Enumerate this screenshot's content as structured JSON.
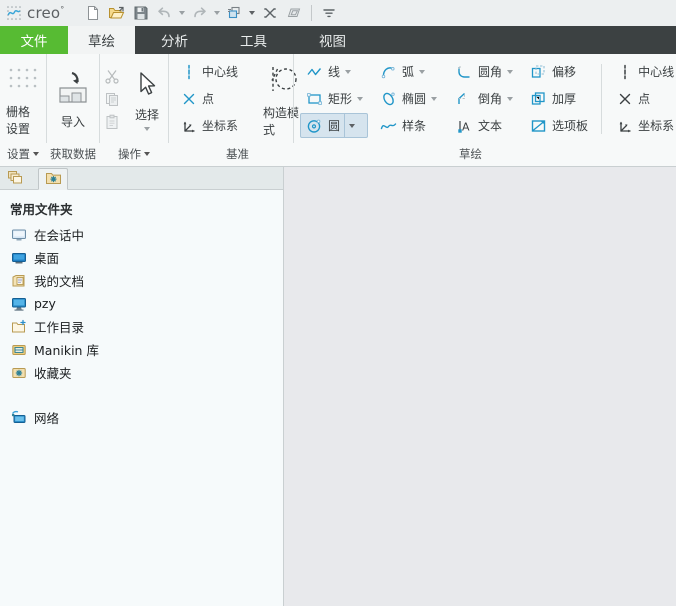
{
  "app": {
    "brand": "creo",
    "brand_sup": "°"
  },
  "quick_access": {
    "buttons": [
      {
        "name": "new-file",
        "icon": "new-document-icon"
      },
      {
        "name": "open-file",
        "icon": "open-folder-icon"
      },
      {
        "name": "save-file",
        "icon": "save-disk-icon"
      },
      {
        "name": "undo",
        "icon": "undo-arrow-icon",
        "has_caret": true
      },
      {
        "name": "redo",
        "icon": "redo-arrow-icon",
        "has_caret": true
      },
      {
        "name": "regenerate",
        "icon": "regenerate-icon",
        "has_caret": true
      },
      {
        "name": "close-window",
        "icon": "close-x-icon"
      },
      {
        "name": "window-switch",
        "icon": "window-stack-icon"
      }
    ],
    "overflow": "customize-quick-access-icon"
  },
  "tabs": [
    {
      "id": "file",
      "label": "文件",
      "state": "file"
    },
    {
      "id": "sketch",
      "label": "草绘",
      "state": "active"
    },
    {
      "id": "analysis",
      "label": "分析",
      "state": "normal"
    },
    {
      "id": "tools",
      "label": "工具",
      "state": "normal"
    },
    {
      "id": "view",
      "label": "视图",
      "state": "normal"
    }
  ],
  "ribbon": {
    "groups": [
      {
        "id": "settings",
        "label": "设置",
        "label_caret": true,
        "big_buttons": [
          {
            "name": "grid-settings-button",
            "label": "栅格设置",
            "icon": "grid-dots-icon"
          }
        ]
      },
      {
        "id": "get-data",
        "label": "获取数据",
        "label_caret": false,
        "big_buttons": [
          {
            "name": "import-button",
            "label": "导入",
            "icon": "import-arrow-icon"
          }
        ]
      },
      {
        "id": "operations",
        "label": "操作",
        "label_caret": true,
        "small_icons": [
          {
            "name": "cut-button",
            "icon": "scissors-icon",
            "disabled": true
          },
          {
            "name": "copy-button",
            "icon": "copy-pages-icon",
            "disabled": true
          },
          {
            "name": "paste-button",
            "icon": "clipboard-icon",
            "disabled": true
          }
        ],
        "big_buttons": [
          {
            "name": "select-button",
            "label": "选择",
            "icon": "cursor-arrow-icon",
            "has_caret": true
          }
        ]
      },
      {
        "id": "datum",
        "label": "基准",
        "label_caret": false,
        "items": [
          {
            "name": "centerline-button",
            "label": "中心线",
            "icon": "centerline-icon"
          },
          {
            "name": "point-button",
            "label": "点",
            "icon": "datum-point-icon"
          },
          {
            "name": "coordinate-system-button",
            "label": "坐标系",
            "icon": "coordinate-system-icon"
          }
        ],
        "big_buttons": [
          {
            "name": "construction-mode-button",
            "label": "构造模式",
            "icon": "construction-mode-icon"
          }
        ]
      },
      {
        "id": "sketching",
        "label": "草绘",
        "label_caret": false,
        "columns": [
          [
            {
              "name": "line-button",
              "label": "线",
              "icon": "line-chain-icon",
              "has_caret": true
            },
            {
              "name": "rectangle-button",
              "label": "矩形",
              "icon": "rectangle-icon",
              "has_caret": true
            },
            {
              "name": "circle-button",
              "label": "圆",
              "icon": "circle-icon",
              "has_caret": true,
              "active": true,
              "split": true
            }
          ],
          [
            {
              "name": "arc-button",
              "label": "弧",
              "icon": "arc-icon",
              "has_caret": true
            },
            {
              "name": "ellipse-button",
              "label": "椭圆",
              "icon": "ellipse-icon",
              "has_caret": true
            },
            {
              "name": "spline-button",
              "label": "样条",
              "icon": "spline-icon",
              "has_caret": false
            }
          ],
          [
            {
              "name": "fillet-button",
              "label": "圆角",
              "icon": "fillet-icon",
              "has_caret": true
            },
            {
              "name": "chamfer-button",
              "label": "倒角",
              "icon": "chamfer-icon",
              "has_caret": true
            },
            {
              "name": "text-button",
              "label": "文本",
              "icon": "text-a-icon",
              "has_caret": false
            }
          ],
          [
            {
              "name": "offset-button",
              "label": "偏移",
              "icon": "offset-icon",
              "has_caret": false
            },
            {
              "name": "thicken-button",
              "label": "加厚",
              "icon": "thicken-icon",
              "has_caret": false
            },
            {
              "name": "palette-button",
              "label": "选项板",
              "icon": "palette-icon",
              "has_caret": false
            }
          ],
          [
            {
              "name": "centerline-button-2",
              "label": "中心线",
              "icon": "centerline-icon",
              "has_caret": true
            },
            {
              "name": "point-button-2",
              "label": "点",
              "icon": "datum-point-icon",
              "has_caret": false
            },
            {
              "name": "coordinate-system-button-2",
              "label": "坐标系",
              "icon": "coordinate-system-icon",
              "has_caret": false
            }
          ]
        ]
      }
    ]
  },
  "navigator": {
    "tabs": [
      {
        "name": "model-tree-tab",
        "icon": "folders-stack-icon",
        "selected": false
      },
      {
        "name": "favorites-tab",
        "icon": "favorites-folder-icon",
        "selected": true
      }
    ],
    "header": "常用文件夹",
    "items": [
      {
        "label": "在会话中",
        "icon": "in-session-monitor-icon"
      },
      {
        "label": "桌面",
        "icon": "desktop-icon"
      },
      {
        "label": "我的文档",
        "icon": "my-documents-icon"
      },
      {
        "label": "pzy",
        "icon": "user-computer-icon"
      },
      {
        "label": "工作目录",
        "icon": "working-directory-folder-icon"
      },
      {
        "label": "Manikin 库",
        "icon": "manikin-library-icon"
      },
      {
        "label": "收藏夹",
        "icon": "favorites-folder-icon"
      }
    ],
    "network_item": {
      "label": "网络",
      "icon": "network-icon"
    }
  },
  "graphics": {
    "annotation": {
      "name": "magenta-pointer-arrow",
      "color": "#e838e8"
    },
    "cursor": {
      "name": "sketch-crosshair-cursor",
      "color": "#b03fc0",
      "center_color": "#39b6d8"
    }
  },
  "colors": {
    "tab_bar": "#3c4142",
    "file_tab": "#57bb33",
    "ribbon_bg": "#f7f9f9",
    "sidebar_bg": "#f6fafb",
    "graphics_bg": "#e8e9ec",
    "icon_blue": "#2196c8",
    "accent_magenta": "#e838e8"
  }
}
